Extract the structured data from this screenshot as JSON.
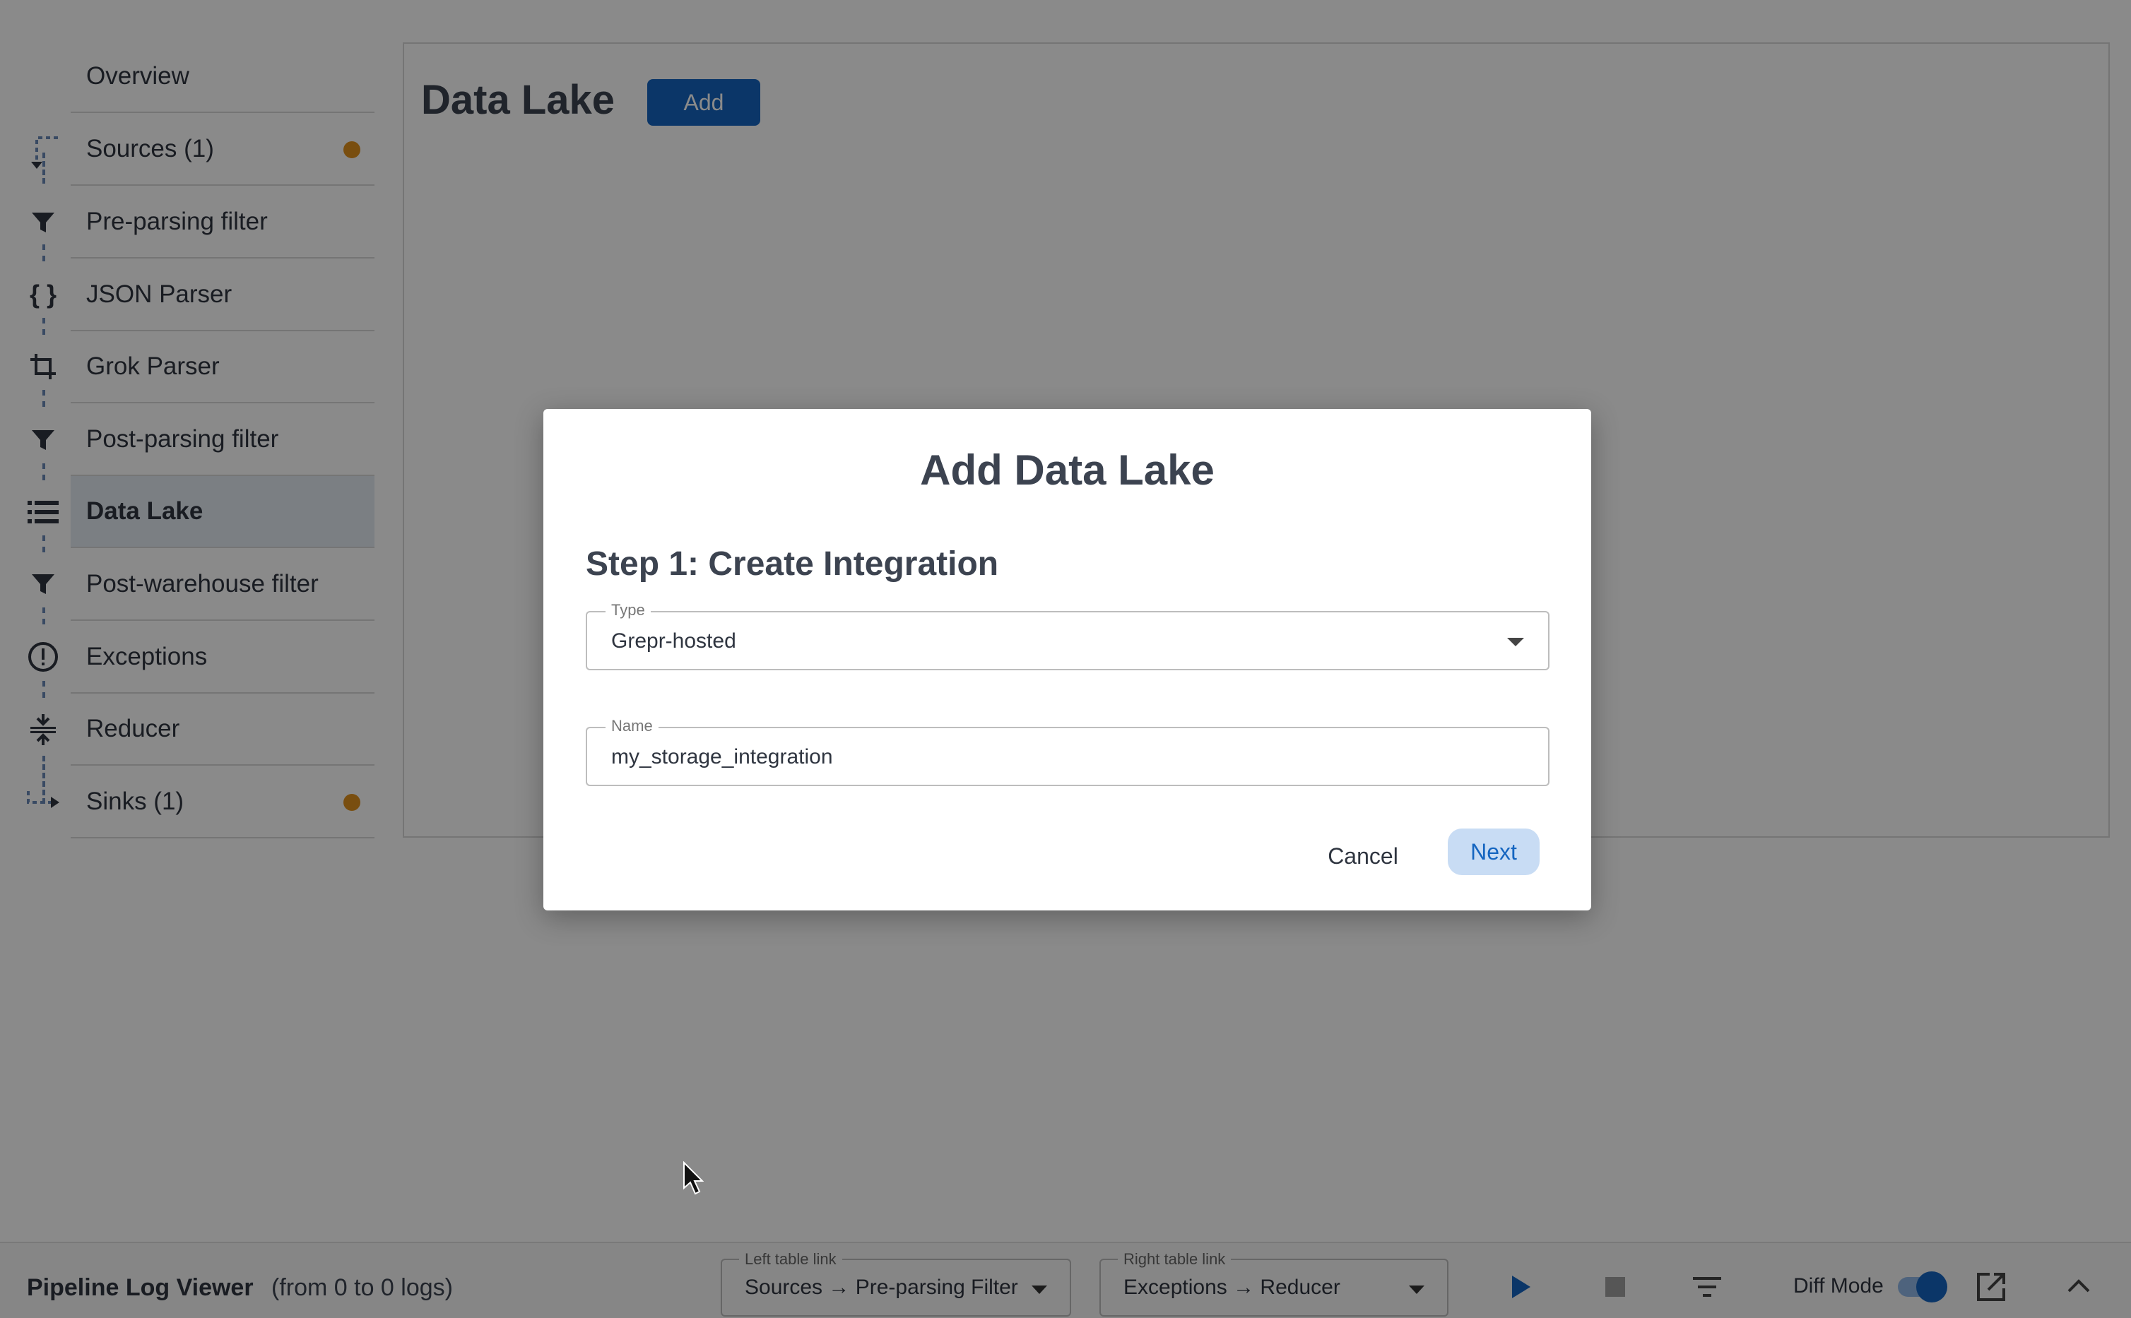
{
  "sidebar": {
    "items": [
      {
        "label": "Overview",
        "icon": "none",
        "badge": false
      },
      {
        "label": "Sources (1)",
        "icon": "corner-arrow-icon",
        "badge": true
      },
      {
        "label": "Pre-parsing filter",
        "icon": "filter-icon",
        "badge": false
      },
      {
        "label": "JSON Parser",
        "icon": "braces-icon",
        "badge": false
      },
      {
        "label": "Grok Parser",
        "icon": "crop-icon",
        "badge": false
      },
      {
        "label": "Post-parsing filter",
        "icon": "filter-icon",
        "badge": false
      },
      {
        "label": "Data Lake",
        "icon": "list-icon",
        "badge": false,
        "active": true
      },
      {
        "label": "Post-warehouse filter",
        "icon": "filter-icon",
        "badge": false
      },
      {
        "label": "Exceptions",
        "icon": "exclamation-circle-icon",
        "badge": false
      },
      {
        "label": "Reducer",
        "icon": "compress-icon",
        "badge": false
      },
      {
        "label": "Sinks (1)",
        "icon": "corner-arrow-icon",
        "badge": true
      }
    ]
  },
  "main": {
    "title": "Data Lake",
    "add_label": "Add"
  },
  "modal": {
    "title": "Add Data Lake",
    "step_title": "Step 1: Create Integration",
    "type_legend": "Type",
    "type_value": "Grepr-hosted",
    "name_legend": "Name",
    "name_value": "my_storage_integration",
    "cancel_label": "Cancel",
    "next_label": "Next"
  },
  "bottom_bar": {
    "title": "Pipeline Log Viewer",
    "subtitle": "(from 0 to 0 logs)",
    "left_link_legend": "Left table link",
    "left_link_value": "Sources → Pre-parsing Filter",
    "right_link_legend": "Right table link",
    "right_link_value": "Exceptions → Reducer",
    "diff_mode_label": "Diff Mode",
    "diff_mode_on": true
  },
  "colors": {
    "accent": "#1565c0",
    "badge": "#e0901c",
    "active_bg": "#e3ebf3"
  }
}
